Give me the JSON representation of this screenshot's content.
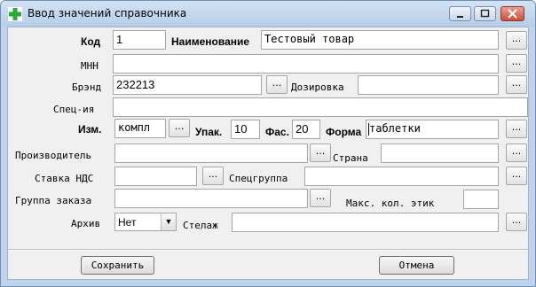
{
  "window": {
    "title": "Ввод значений справочника",
    "icon": "green-cross-icon"
  },
  "fields": {
    "kod": {
      "label": "Код",
      "value": "1"
    },
    "naimenovanie": {
      "label": "Наименование",
      "value": "Тестовый товар"
    },
    "mnn": {
      "label": "МНН",
      "value": ""
    },
    "brand": {
      "label": "Брэнд",
      "value": "232213"
    },
    "dozirovka": {
      "label": "Дозировка",
      "value": ""
    },
    "spec": {
      "label": "Спец-ия",
      "value": ""
    },
    "izm": {
      "label": "Изм.",
      "value": "компл"
    },
    "upak": {
      "label": "Упак.",
      "value": "10"
    },
    "fas": {
      "label": "Фас.",
      "value": "20"
    },
    "forma": {
      "label": "Форма",
      "value": "таблетки"
    },
    "proizvoditel": {
      "label": "Производитель",
      "value": ""
    },
    "strana": {
      "label": "Страна",
      "value": ""
    },
    "nds": {
      "label": "Ставка НДС",
      "value": ""
    },
    "specgruppa": {
      "label": "Спецгруппа",
      "value": ""
    },
    "gruppa_zakaza": {
      "label": "Группа заказа",
      "value": ""
    },
    "maks_etik": {
      "label": "Макс. кол. этик",
      "value": ""
    },
    "arhiv": {
      "label": "Архив",
      "value": "Нет"
    },
    "stelazh": {
      "label": "Стелаж",
      "value": ""
    }
  },
  "lookup_button_label": "...",
  "buttons": {
    "save": "Сохранить",
    "cancel": "Отмена"
  }
}
